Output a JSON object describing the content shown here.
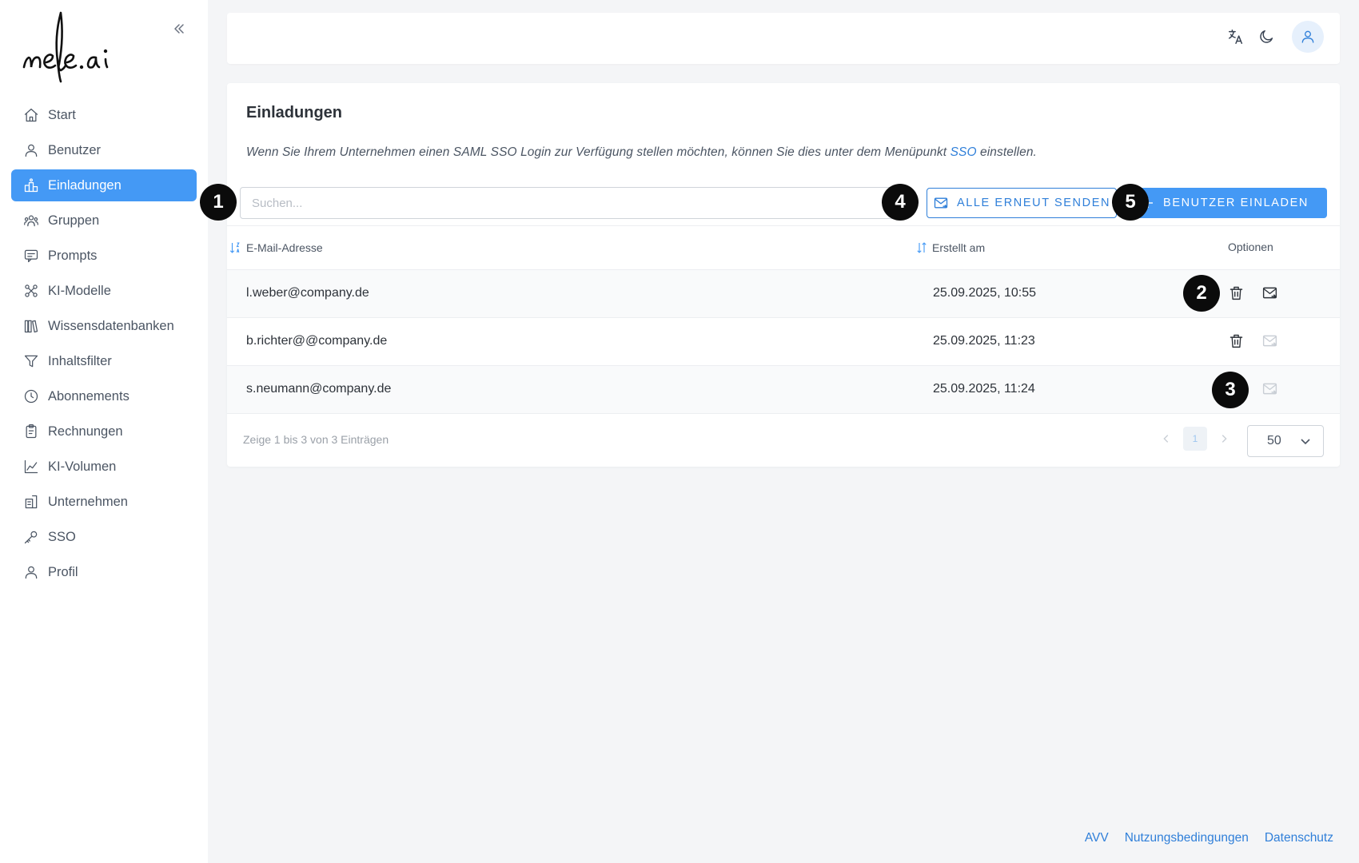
{
  "brand": {
    "logo_text": "nele.ai"
  },
  "sidebar": {
    "collapse_icon": "double-chevron-left-icon",
    "items": [
      {
        "label": "Start",
        "icon": "home-icon"
      },
      {
        "label": "Benutzer",
        "icon": "user-icon"
      },
      {
        "label": "Einladungen",
        "icon": "invitations-icon",
        "active": true
      },
      {
        "label": "Gruppen",
        "icon": "group-icon"
      },
      {
        "label": "Prompts",
        "icon": "prompt-icon"
      },
      {
        "label": "KI-Modelle",
        "icon": "model-icon"
      },
      {
        "label": "Wissensdatenbanken",
        "icon": "library-icon"
      },
      {
        "label": "Inhaltsfilter",
        "icon": "filter-icon"
      },
      {
        "label": "Abonnements",
        "icon": "clock-icon"
      },
      {
        "label": "Rechnungen",
        "icon": "clipboard-icon"
      },
      {
        "label": "KI-Volumen",
        "icon": "chart-icon"
      },
      {
        "label": "Unternehmen",
        "icon": "building-icon"
      },
      {
        "label": "SSO",
        "icon": "key-icon"
      },
      {
        "label": "Profil",
        "icon": "user-icon"
      }
    ]
  },
  "topbar": {
    "icons": [
      "translate-icon",
      "moon-icon",
      "user-avatar-icon"
    ]
  },
  "main": {
    "title": "Einladungen",
    "description_before": "Wenn Sie Ihrem Unternehmen einen SAML SSO Login zur Verfügung stellen möchten, können Sie dies unter dem Menüpunkt ",
    "description_link": "SSO",
    "description_after": " einstellen.",
    "search_placeholder": "Suchen...",
    "resend_all_label": "ALLE ERNEUT SENDEN",
    "invite_label": "BENUTZER EINLADEN",
    "table": {
      "columns": [
        "E-Mail-Adresse",
        "Erstellt am",
        "Optionen"
      ],
      "rows": [
        {
          "email": "l.weber@company.de",
          "created": "25.09.2025, 10:55"
        },
        {
          "email": "b.richter@@company.de",
          "created": "25.09.2025, 11:23"
        },
        {
          "email": "s.neumann@company.de",
          "created": "25.09.2025, 11:24"
        }
      ]
    },
    "pagination": {
      "info": "Zeige 1 bis 3 von 3 Einträgen",
      "current_page": "1",
      "per_page": "50"
    }
  },
  "markers": [
    "1",
    "2",
    "3",
    "4",
    "5"
  ],
  "footer": {
    "links": [
      "AVV",
      "Nutzungsbedingungen",
      "Datenschutz"
    ]
  },
  "colors": {
    "accent": "#4499f5",
    "link": "#2f7fd9",
    "background": "#f4f5f7"
  }
}
